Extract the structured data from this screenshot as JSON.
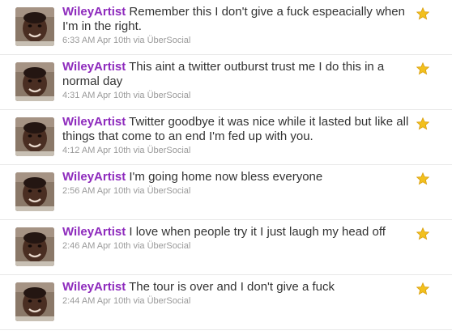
{
  "colors": {
    "author": "#8e2bbd",
    "text": "#333333",
    "meta": "#999999",
    "star": "#f2c01e",
    "divider": "#e8e8e8"
  },
  "tweets": [
    {
      "author": "WileyArtist",
      "text": "Remember this I don't give a fuck espeacially when I'm in the right.",
      "time": "6:33 AM Apr 10th",
      "via": "via ÜberSocial",
      "favorite_icon": "star-icon"
    },
    {
      "author": "WileyArtist",
      "text": "This aint a twitter outburst trust me I do this in a normal day",
      "time": "4:31 AM Apr 10th",
      "via": "via ÜberSocial",
      "favorite_icon": "star-icon"
    },
    {
      "author": "WileyArtist",
      "text": "Twitter goodbye it was nice while it lasted but like all things that come to an end I'm fed up with you.",
      "time": "4:12 AM Apr 10th",
      "via": "via ÜberSocial",
      "favorite_icon": "star-icon"
    },
    {
      "author": "WileyArtist",
      "text": "I'm going home now bless everyone",
      "time": "2:56 AM Apr 10th",
      "via": "via ÜberSocial",
      "favorite_icon": "star-icon"
    },
    {
      "author": "WileyArtist",
      "text": "I love when people try it I just laugh my head off",
      "time": "2:46 AM Apr 10th",
      "via": "via ÜberSocial",
      "favorite_icon": "star-icon"
    },
    {
      "author": "WileyArtist",
      "text": "The tour is over and I don't give a fuck",
      "time": "2:44 AM Apr 10th",
      "via": "via ÜberSocial",
      "favorite_icon": "star-icon"
    }
  ]
}
